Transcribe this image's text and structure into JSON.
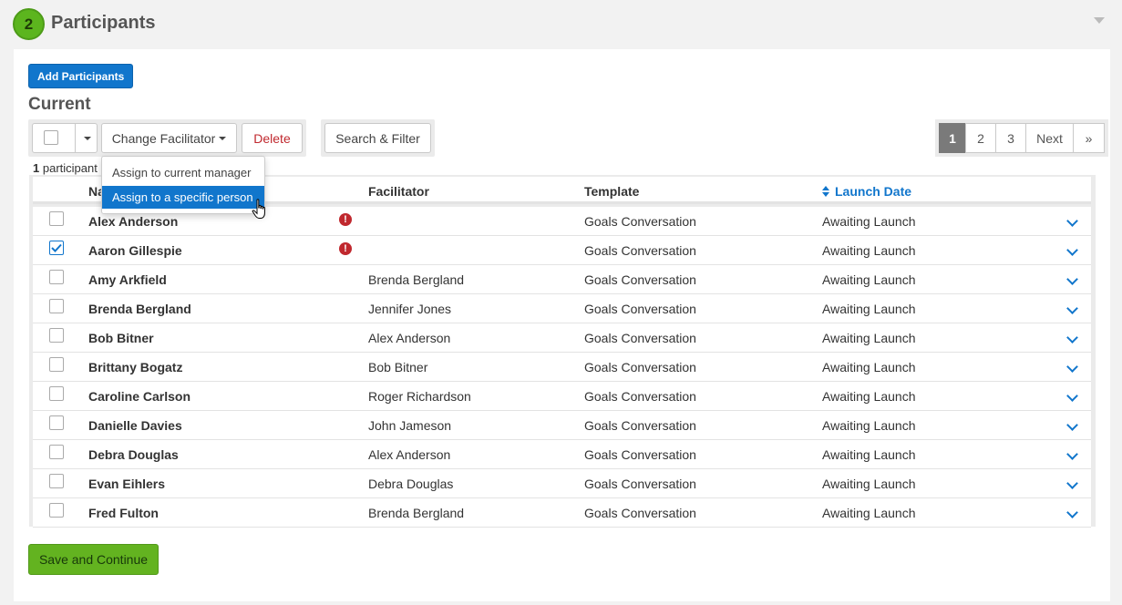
{
  "section": {
    "step_number": "2",
    "title": "Participants"
  },
  "add_button": "Add Participants",
  "current_label": "Current",
  "toolbar": {
    "change_facilitator": "Change Facilitator",
    "delete": "Delete",
    "search_filter": "Search & Filter"
  },
  "pagination": {
    "pages": [
      "1",
      "2",
      "3"
    ],
    "active": "1",
    "next": "Next",
    "last": "»"
  },
  "count": {
    "number": "1",
    "label": "participant"
  },
  "table": {
    "headers": {
      "name": "Name",
      "facilitator": "Facilitator",
      "template": "Template",
      "launch_date": "Launch Date"
    },
    "rows": [
      {
        "name": "Alex Anderson",
        "facilitator": "",
        "template": "Goals Conversation",
        "launch": "Awaiting Launch",
        "checked": false,
        "alert": true
      },
      {
        "name": "Aaron Gillespie",
        "facilitator": "",
        "template": "Goals Conversation",
        "launch": "Awaiting Launch",
        "checked": true,
        "alert": true
      },
      {
        "name": "Amy Arkfield",
        "facilitator": "Brenda Bergland",
        "template": "Goals Conversation",
        "launch": "Awaiting Launch",
        "checked": false,
        "alert": false
      },
      {
        "name": "Brenda Bergland",
        "facilitator": "Jennifer Jones",
        "template": "Goals Conversation",
        "launch": "Awaiting Launch",
        "checked": false,
        "alert": false
      },
      {
        "name": "Bob Bitner",
        "facilitator": "Alex Anderson",
        "template": "Goals Conversation",
        "launch": "Awaiting Launch",
        "checked": false,
        "alert": false
      },
      {
        "name": "Brittany Bogatz",
        "facilitator": "Bob Bitner",
        "template": "Goals Conversation",
        "launch": "Awaiting Launch",
        "checked": false,
        "alert": false
      },
      {
        "name": "Caroline Carlson",
        "facilitator": "Roger Richardson",
        "template": "Goals Conversation",
        "launch": "Awaiting Launch",
        "checked": false,
        "alert": false
      },
      {
        "name": "Danielle Davies",
        "facilitator": "John Jameson",
        "template": "Goals Conversation",
        "launch": "Awaiting Launch",
        "checked": false,
        "alert": false
      },
      {
        "name": "Debra Douglas",
        "facilitator": "Alex Anderson",
        "template": "Goals Conversation",
        "launch": "Awaiting Launch",
        "checked": false,
        "alert": false
      },
      {
        "name": "Evan Eihlers",
        "facilitator": "Debra Douglas",
        "template": "Goals Conversation",
        "launch": "Awaiting Launch",
        "checked": false,
        "alert": false
      },
      {
        "name": "Fred Fulton",
        "facilitator": "Brenda Bergland",
        "template": "Goals Conversation",
        "launch": "Awaiting Launch",
        "checked": false,
        "alert": false
      }
    ]
  },
  "dropdown": {
    "items": [
      "Assign to current manager",
      "Assign to a specific person"
    ],
    "highlighted": 1
  },
  "save_button": "Save and Continue",
  "icons": {
    "alert": "exclamation-circle-icon",
    "expand": "chevron-down-icon",
    "sort": "sort-icon",
    "cursor": "hand-pointer-cursor-icon"
  },
  "colors": {
    "accent": "#1176cc",
    "success": "#63b320",
    "danger": "#c0282e"
  }
}
